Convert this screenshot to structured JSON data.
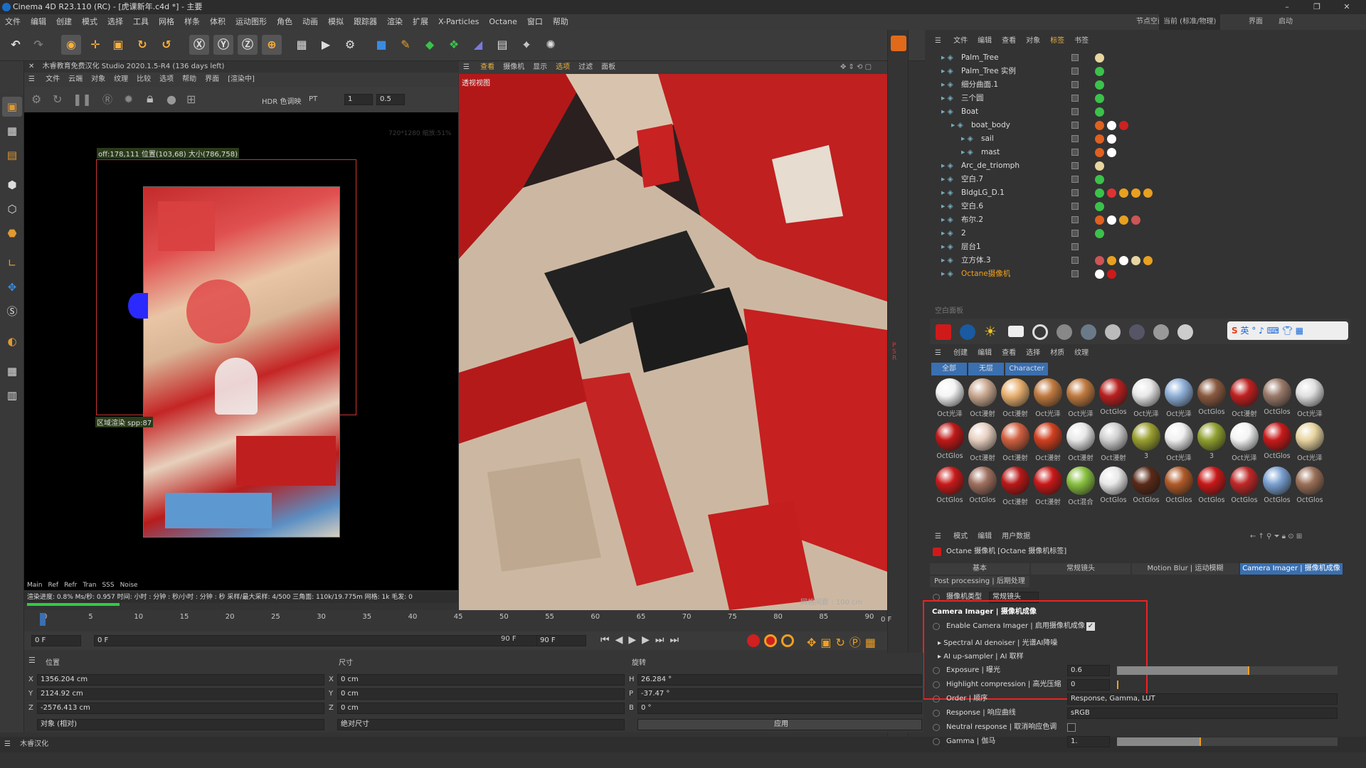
{
  "app": {
    "title": "Cinema 4D R23.110 (RC) - [虎课新年.c4d *] - 主要",
    "win_min": "–",
    "win_max": "❐",
    "win_close": "✕"
  },
  "menubar": {
    "items": [
      "文件",
      "编辑",
      "创建",
      "模式",
      "选择",
      "工具",
      "网格",
      "样条",
      "体积",
      "运动图形",
      "角色",
      "动画",
      "模拟",
      "跟踪器",
      "渲染",
      "扩展",
      "X-Particles",
      "Octane",
      "窗口",
      "帮助"
    ],
    "layout_label": "节点空间:",
    "layout_value": "当前 (标准/物理)",
    "extra1": "界面",
    "extra2": "启动"
  },
  "live_viewer": {
    "header": "木睿教育免费汉化 Studio 2020.1.5-R4 (136 days left)",
    "menu": [
      "文件",
      "云端",
      "对象",
      "纹理",
      "比较",
      "选项",
      "帮助",
      "界面",
      "[渲染中]"
    ],
    "hdr_label": "HDR 色调映",
    "pt_label": "PT",
    "val1": "1",
    "val2": "0.5",
    "region_info": "off:178,111 位置(103,68) 大小(786,758)",
    "region_render": "区域渲染 spp:87",
    "res_info": "720*1280 缩放:51%",
    "tabs": [
      "Main",
      "Ref",
      "Refr",
      "Tran",
      "SSS",
      "Noise"
    ],
    "status": "渲染进度: 0.8%   Ms/秒: 0.957  时间: 小时 : 分钟 : 秒/小时 : 分钟 : 秒   采样/最大采样: 4/500   三角面: 110k/19.775m   网格: 1k   毛发: 0"
  },
  "viewport": {
    "menu": [
      "查看",
      "摄像机",
      "显示",
      "选项",
      "过滤",
      "面板"
    ],
    "label": "透视视图",
    "grid": "网格间距 : 100 cm"
  },
  "object_manager": {
    "menu": [
      "文件",
      "编辑",
      "查看",
      "对象",
      "标签",
      "书签"
    ],
    "objects": [
      {
        "name": "Palm_Tree",
        "indent": 0
      },
      {
        "name": "Palm_Tree 实例",
        "indent": 0
      },
      {
        "name": "细分曲面.1",
        "indent": 0
      },
      {
        "name": "三个圆",
        "indent": 0
      },
      {
        "name": "Boat",
        "indent": 0
      },
      {
        "name": "boat_body",
        "indent": 1
      },
      {
        "name": "sail",
        "indent": 2
      },
      {
        "name": "mast",
        "indent": 2
      },
      {
        "name": "Arc_de_triomph",
        "indent": 0
      },
      {
        "name": "空白.7",
        "indent": 0
      },
      {
        "name": "BldgLG_D.1",
        "indent": 0
      },
      {
        "name": "空白.6",
        "indent": 0
      },
      {
        "name": "布尔.2",
        "indent": 0
      },
      {
        "name": "2",
        "indent": 0
      },
      {
        "name": "层台1",
        "indent": 0
      },
      {
        "name": "立方体.3",
        "indent": 0
      },
      {
        "name": "Octane摄像机",
        "indent": 0
      }
    ]
  },
  "material_manager": {
    "panel_label": "空白面板",
    "menu": [
      "创建",
      "编辑",
      "查看",
      "选择",
      "材质",
      "纹理"
    ],
    "tabs": [
      "全部",
      "无层",
      "Character"
    ],
    "ime": "英",
    "materials": [
      "Oct光泽",
      "Oct漫射",
      "Oct漫射",
      "Oct光泽",
      "Oct光泽",
      "OctGlos",
      "Oct光泽",
      "Oct光泽",
      "OctGlos",
      "Oct漫射",
      "OctGlos",
      "Oct光泽",
      "OctGlos",
      "Oct漫射",
      "Oct漫射",
      "Oct漫射",
      "Oct漫射",
      "Oct漫射",
      "3",
      "Oct光泽",
      "3",
      "Oct光泽",
      "OctGlos",
      "Oct光泽",
      "OctGlos",
      "OctGlos",
      "Oct漫射",
      "Oct漫射",
      "Oct混合",
      "OctGlos",
      "OctGlos",
      "OctGlos",
      "OctGlos",
      "OctGlos",
      "OctGlos",
      "OctGlos"
    ]
  },
  "attributes": {
    "menu": [
      "模式",
      "编辑",
      "用户数据"
    ],
    "title": "Octane 摄像机 [Octane 摄像机标签]",
    "tabs": [
      "基本",
      "常规镜头",
      "Motion Blur | 运动模糊",
      "Camera Imager | 摄像机成像"
    ],
    "tab2": "Post processing | 后期处理",
    "cam_type_label": "摄像机类型",
    "cam_type_value": "常规镜头",
    "section": "Camera Imager | 摄像机成像",
    "enable_label": "Enable Camera Imager | 启用摄像机成像",
    "denoiser": "Spectral AI denoiser | 光谱AI降噪",
    "upsampler": "AI up-sampler | AI 取样",
    "exposure_label": "Exposure | 曝光",
    "exposure_value": "0.6",
    "highlight_label": "Highlight compression | 高光压缩",
    "highlight_value": "0",
    "order_label": "Order | 顺序",
    "order_value": "Response, Gamma, LUT",
    "response_label": "Response | 响应曲线",
    "response_value": "sRGB",
    "neutral_label": "Neutral response | 取消响应色调",
    "gamma_label": "Gamma | 伽马",
    "gamma_value": "1.",
    "exposure_fraction": 0.6,
    "gamma_fraction": 0.38
  },
  "timeline": {
    "ticks": [
      "0",
      "5",
      "10",
      "15",
      "20",
      "25",
      "30",
      "35",
      "40",
      "45",
      "50",
      "55",
      "60",
      "65",
      "70",
      "75",
      "80",
      "85",
      "90"
    ],
    "end_label": "0 F",
    "frame_start": "0 F",
    "frame_cur": "0 F",
    "frame_end": "90 F",
    "frame_end2": "90 F"
  },
  "coordinates": {
    "pos_label": "位置",
    "size_label": "尺寸",
    "rot_label": "旋转",
    "x": "1356.204 cm",
    "y": "2124.92 cm",
    "z": "-2576.413 cm",
    "sx": "0 cm",
    "sy": "0 cm",
    "sz": "0 cm",
    "h": "26.284 °",
    "p": "-37.47 °",
    "b": "0 °",
    "mode1": "对象 (相对)",
    "mode2": "绝对尺寸",
    "apply": "应用"
  },
  "status": {
    "text": "木睿汉化"
  }
}
